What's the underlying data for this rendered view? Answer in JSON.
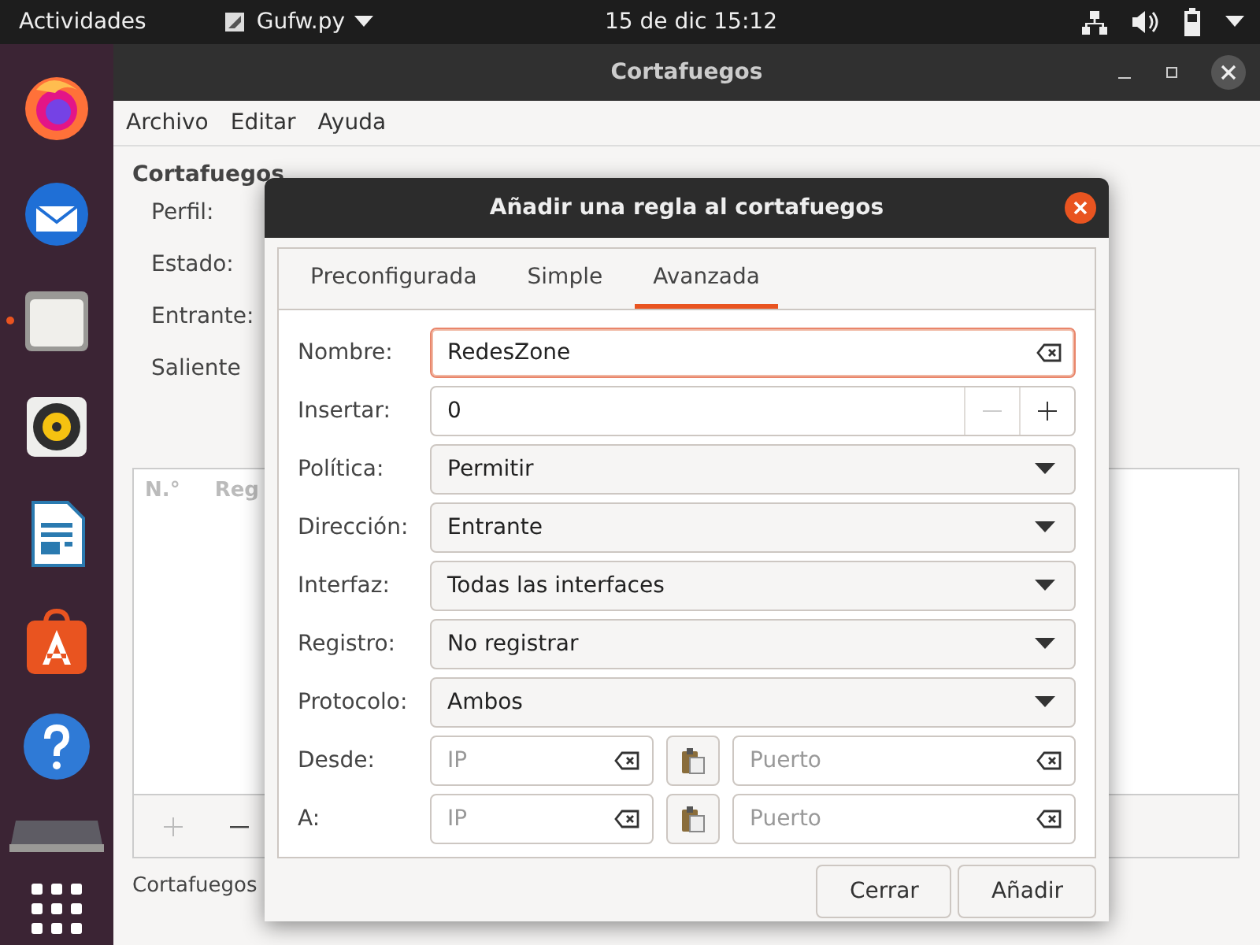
{
  "top_bar": {
    "activities": "Actividades",
    "app_menu": "Gufw.py",
    "clock": "15 de dic  15:12"
  },
  "dock": [
    {
      "kind": "firefox",
      "running": false
    },
    {
      "kind": "mail",
      "running": false
    },
    {
      "kind": "files",
      "running": true
    },
    {
      "kind": "music",
      "running": false
    },
    {
      "kind": "writer",
      "running": false
    },
    {
      "kind": "store",
      "running": false
    },
    {
      "kind": "help",
      "running": false
    },
    {
      "kind": "drive",
      "running": false
    },
    {
      "kind": "grid",
      "running": false
    }
  ],
  "window": {
    "title": "Cortafuegos",
    "menu": [
      "Archivo",
      "Editar",
      "Ayuda"
    ],
    "heading": "Cortafuegos",
    "labels": [
      "Perfil:",
      "Estado:",
      "Entrante:",
      "Saliente"
    ],
    "table": {
      "columns": [
        "N.°",
        "Reg"
      ]
    },
    "status_bar": "Cortafuegos"
  },
  "dialog": {
    "title": "Añadir una regla al cortafuegos",
    "tabs": [
      {
        "label": "Preconfigurada",
        "selected": false
      },
      {
        "label": "Simple",
        "selected": false
      },
      {
        "label": "Avanzada",
        "selected": true
      }
    ],
    "fields": [
      {
        "kind": "entry",
        "label": "Nombre:",
        "value": "RedesZone",
        "focused": true
      },
      {
        "kind": "spin",
        "label": "Insertar:",
        "value": "0",
        "decrement_disabled": true
      },
      {
        "kind": "combo",
        "label": "Política:",
        "value": "Permitir"
      },
      {
        "kind": "combo",
        "label": "Dirección:",
        "value": "Entrante"
      },
      {
        "kind": "combo",
        "label": "Interfaz:",
        "value": "Todas las interfaces"
      },
      {
        "kind": "combo",
        "label": "Registro:",
        "value": "No registrar"
      },
      {
        "kind": "combo",
        "label": "Protocolo:",
        "value": "Ambos"
      },
      {
        "kind": "address",
        "label": "Desde:",
        "ip_placeholder": "IP",
        "port_placeholder": "Puerto"
      },
      {
        "kind": "address",
        "label": "A:",
        "ip_placeholder": "IP",
        "port_placeholder": "Puerto"
      }
    ],
    "buttons": [
      "Cerrar",
      "Añadir"
    ]
  }
}
